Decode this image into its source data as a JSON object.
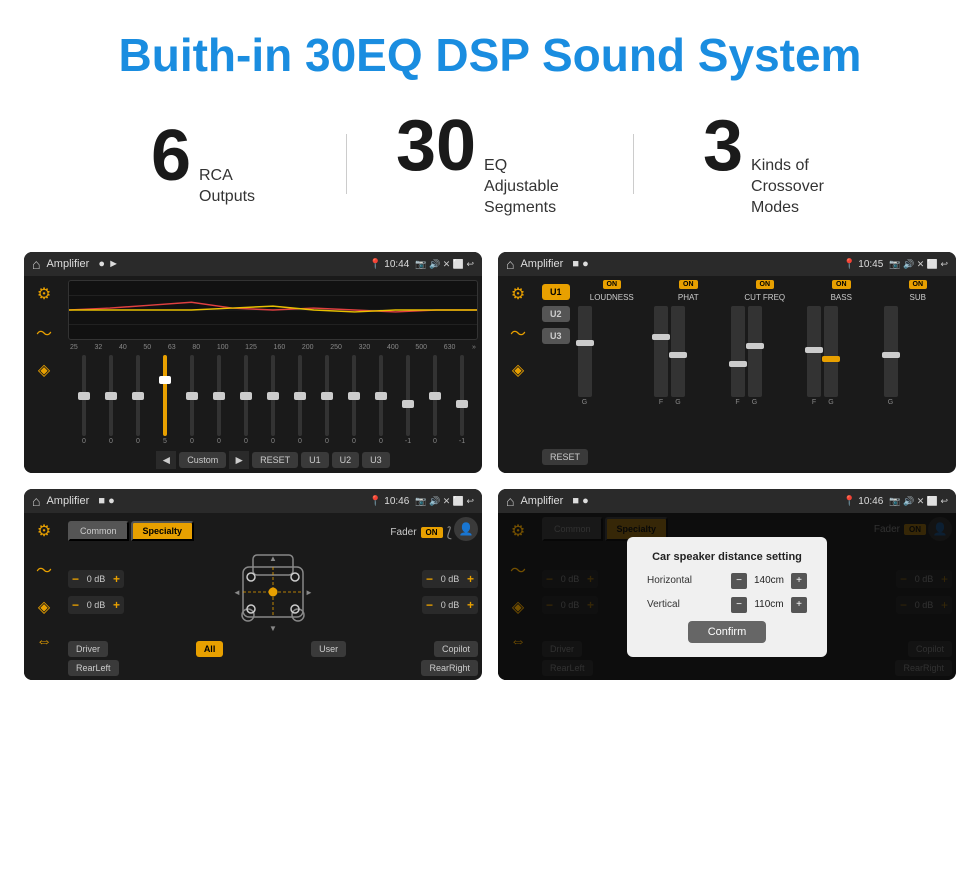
{
  "header": {
    "title": "Buith-in 30EQ DSP Sound System"
  },
  "stats": [
    {
      "number": "6",
      "label": "RCA\nOutputs"
    },
    {
      "number": "30",
      "label": "EQ Adjustable\nSegments"
    },
    {
      "number": "3",
      "label": "Kinds of\nCrossover Modes"
    }
  ],
  "screens": {
    "screen1": {
      "title": "Amplifier",
      "time": "10:44",
      "eq_freqs": [
        "25",
        "32",
        "40",
        "50",
        "63",
        "80",
        "100",
        "125",
        "160",
        "200",
        "250",
        "320",
        "400",
        "500",
        "630"
      ],
      "eq_values": [
        "0",
        "0",
        "0",
        "5",
        "0",
        "0",
        "0",
        "0",
        "0",
        "0",
        "0",
        "0",
        "-1",
        "0",
        "-1"
      ],
      "controls": {
        "back": "◄",
        "label": "Custom",
        "forward": "►",
        "reset": "RESET",
        "u1": "U1",
        "u2": "U2",
        "u3": "U3"
      }
    },
    "screen2": {
      "title": "Amplifier",
      "time": "10:45",
      "presets": [
        "U1",
        "U2",
        "U3"
      ],
      "channels": [
        "LOUDNESS",
        "PHAT",
        "CUT FREQ",
        "BASS",
        "SUB"
      ],
      "on_badge": "ON",
      "reset": "RESET"
    },
    "screen3": {
      "title": "Amplifier",
      "time": "10:46",
      "tabs": [
        "Common",
        "Specialty"
      ],
      "fader_label": "Fader",
      "on_label": "ON",
      "db_values": [
        "0 dB",
        "0 dB",
        "0 dB",
        "0 dB"
      ],
      "bottom_labels": [
        "Driver",
        "All",
        "User",
        "RearRight",
        "Copilot",
        "RearLeft"
      ]
    },
    "screen4": {
      "title": "Amplifier",
      "time": "10:46",
      "tabs": [
        "Common",
        "Specialty"
      ],
      "dialog": {
        "title": "Car speaker distance setting",
        "horizontal_label": "Horizontal",
        "horizontal_value": "140cm",
        "vertical_label": "Vertical",
        "vertical_value": "110cm",
        "confirm_label": "Confirm"
      },
      "db_values": [
        "0 dB",
        "0 dB"
      ],
      "labels": [
        "Driver",
        "RearLeft",
        "All",
        "User",
        "Copilot",
        "RearRight"
      ]
    }
  }
}
